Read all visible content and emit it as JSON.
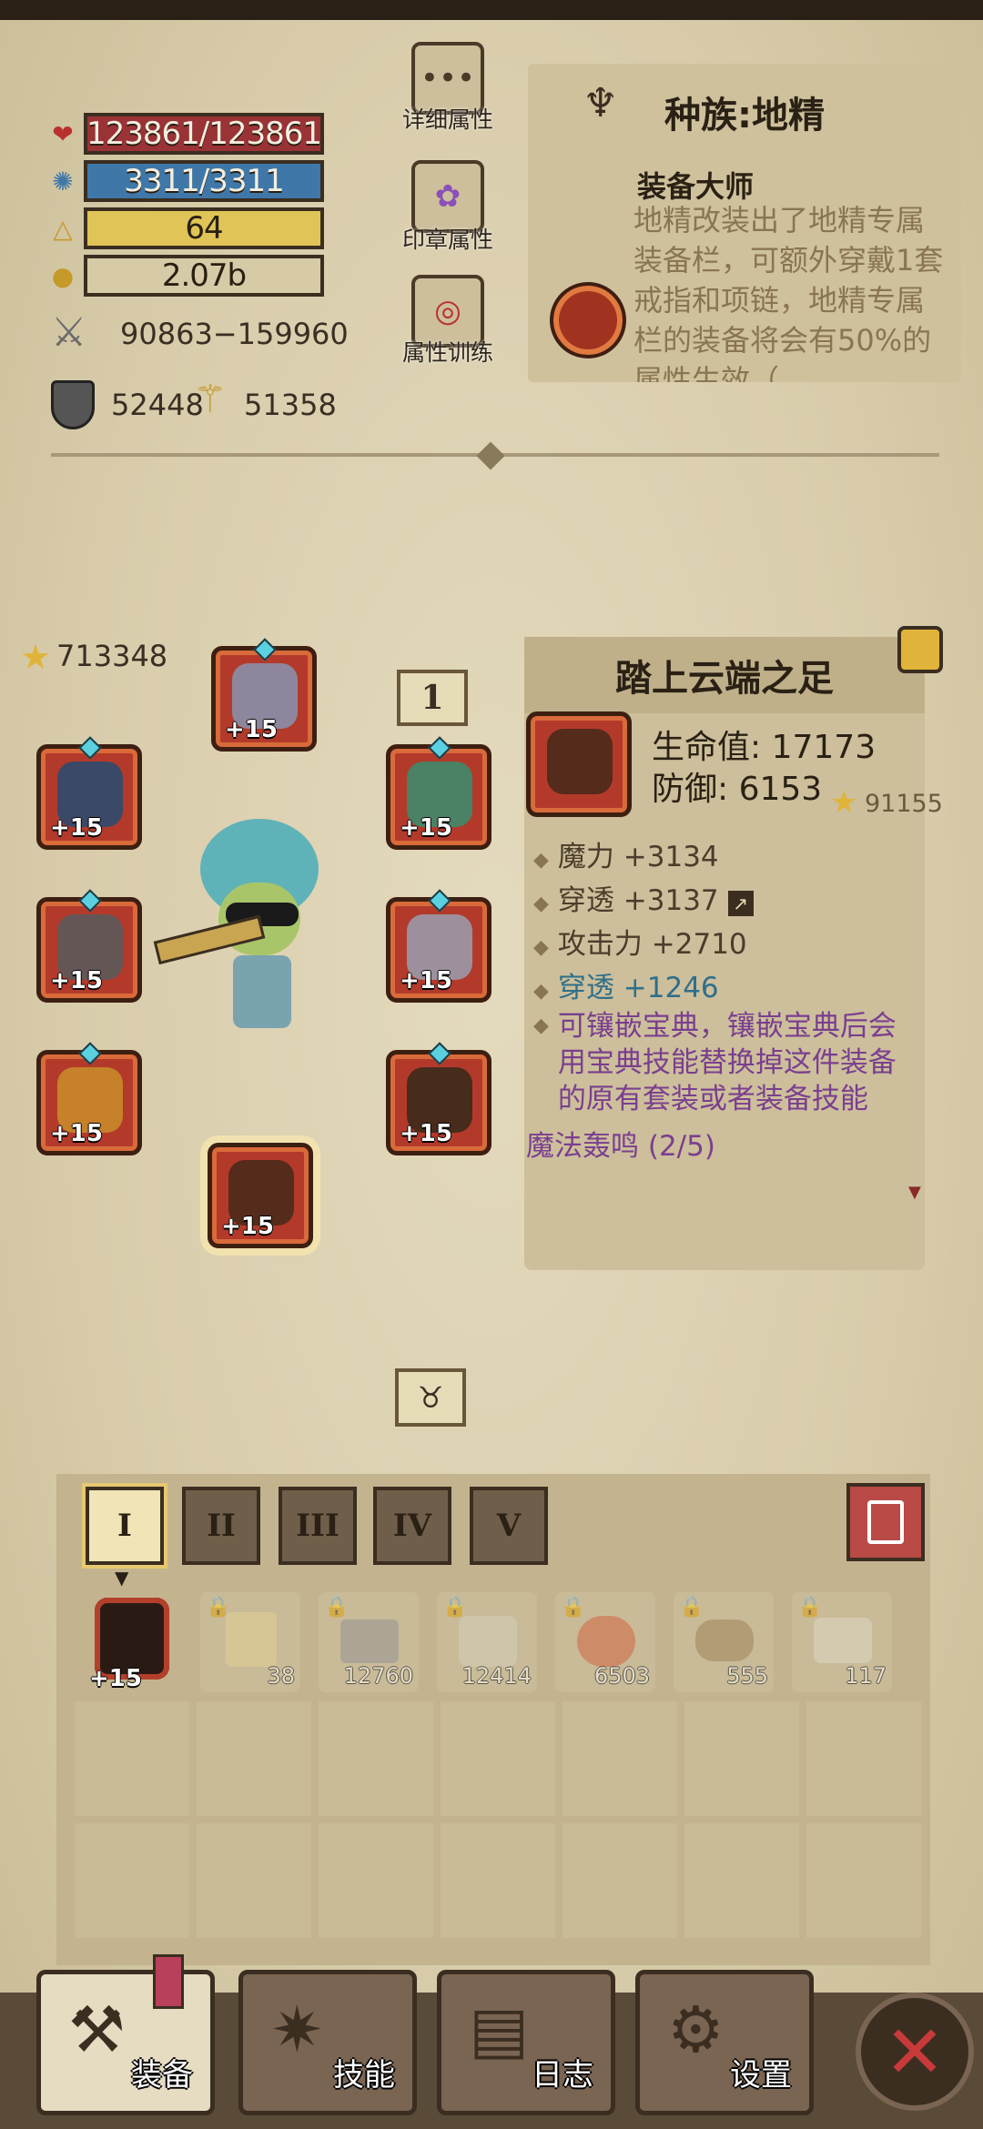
{
  "stats": {
    "hp": "123861/123861",
    "mp": "3311/3311",
    "level": "64",
    "gold": "2.07b",
    "attack": "90863−159960",
    "defense": "52448",
    "magic": "51358"
  },
  "side_buttons": {
    "detail": "详细属性",
    "seal": "印章属性",
    "training": "属性训练"
  },
  "race": {
    "title": "种族:地精",
    "skill_name": "装备大师",
    "skill_desc": "地精改装出了地精专属装备栏，可额外穿戴1套戒指和项链，地精专属栏的装备将会有50%的属性生效（"
  },
  "equip": {
    "power": "713348",
    "tier": "1",
    "slot_plus": "+15"
  },
  "item": {
    "name": "踏上云端之足",
    "hp": "生命值: 17173",
    "def": "防御: 6153",
    "score": "91155",
    "attrs": [
      "魔力 +3134",
      "穿透 +3137",
      "攻击力 +2710",
      "穿透 +1246"
    ],
    "desc": "可镶嵌宝典，镶嵌宝典后会用宝典技能替换掉这件装备的原有套装或者装备技能",
    "set": "魔法轰鸣 (2/5)"
  },
  "tabs": [
    "I",
    "II",
    "III",
    "IV",
    "V"
  ],
  "inventory": {
    "first_plus": "+15",
    "counts": [
      "38",
      "12760",
      "12414",
      "6503",
      "555",
      "117"
    ]
  },
  "nav": {
    "equip": "装备",
    "skill": "技能",
    "log": "日志",
    "settings": "设置"
  },
  "colors": {
    "hp_bar": "#9a3336",
    "mp_bar": "#3f78a8",
    "level_bar": "#e0c457",
    "magic_attr": "#2f6f8a",
    "desc_purple": "#7a3f8f"
  }
}
